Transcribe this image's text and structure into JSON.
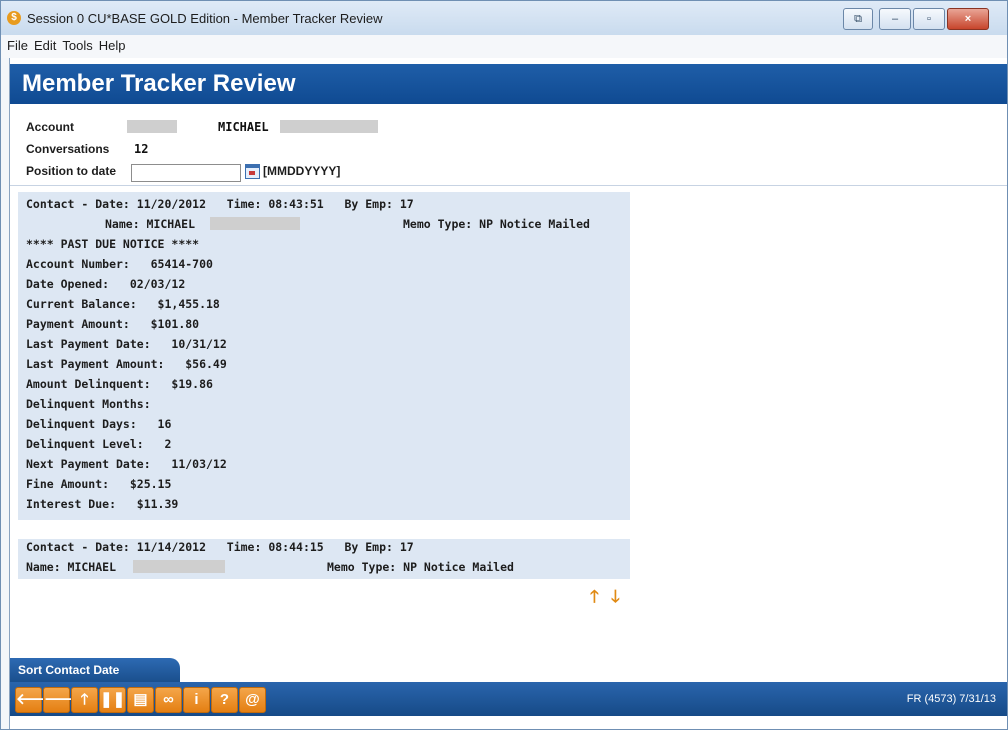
{
  "window": {
    "title": "Session 0 CU*BASE GOLD Edition - Member Tracker Review",
    "app_icon": "$",
    "controls": [
      {
        "name": "restore-view-icon",
        "glyph": "⧉"
      },
      {
        "name": "minimize-icon",
        "glyph": "–"
      },
      {
        "name": "maximize-icon",
        "glyph": "▫"
      },
      {
        "name": "close-icon",
        "glyph": "×"
      }
    ]
  },
  "menu": [
    "File",
    "Edit",
    "Tools",
    "Help"
  ],
  "banner": {
    "title": "Member Tracker Review"
  },
  "header": {
    "account_label": "Account",
    "member_first_name": "MICHAEL",
    "conversations_label": "Conversations",
    "conversations_count": "12",
    "position_label": "Position to date",
    "date_placeholder": "",
    "date_format": "[MMDDYYYY]"
  },
  "contacts": [
    {
      "header": "Contact - Date: 11/20/2012   Time: 08:43:51   By Emp: 17",
      "name_label": "Name: MICHAEL",
      "memo_type": "Memo Type: NP Notice Mailed",
      "lines": [
        "**** PAST DUE NOTICE ****",
        "Account Number:   65414-700",
        "Date Opened:   02/03/12",
        "Current Balance:   $1,455.18",
        "Payment Amount:   $101.80",
        "Last Payment Date:   10/31/12",
        "Last Payment Amount:   $56.49",
        "Amount Delinquent:   $19.86",
        "Delinquent Months:",
        "Delinquent Days:   16",
        "Delinquent Level:   2",
        "Next Payment Date:   11/03/12",
        "Fine Amount:   $25.15",
        "Interest Due:   $11.39"
      ]
    },
    {
      "header": "Contact - Date: 11/14/2012   Time: 08:44:15   By Emp: 17",
      "name_label": "Name: MICHAEL",
      "memo_type": "Memo Type: NP Notice Mailed",
      "lines": []
    }
  ],
  "scroll": {
    "up_glyph": "🡑",
    "down_glyph": "🡓"
  },
  "tab": {
    "label": "Sort Contact Date"
  },
  "toolbar": {
    "buttons": [
      {
        "name": "back-arrow-icon",
        "glyph": "🡐"
      },
      {
        "name": "forward-arrow-icon",
        "glyph": "🡒"
      },
      {
        "name": "up-arrow-icon",
        "glyph": "🡑"
      },
      {
        "name": "pause-icon",
        "glyph": "❚❚"
      },
      {
        "name": "print-icon",
        "glyph": "▤"
      },
      {
        "name": "link-icon",
        "glyph": "∞"
      },
      {
        "name": "info-icon",
        "glyph": "i"
      },
      {
        "name": "help-icon",
        "glyph": "?"
      },
      {
        "name": "at-icon",
        "glyph": "@"
      }
    ],
    "status": "FR (4573) 7/31/13"
  },
  "colors": {
    "banner": "#1457a2",
    "memo_bg": "#dde7f3",
    "accent": "#e47f12"
  }
}
